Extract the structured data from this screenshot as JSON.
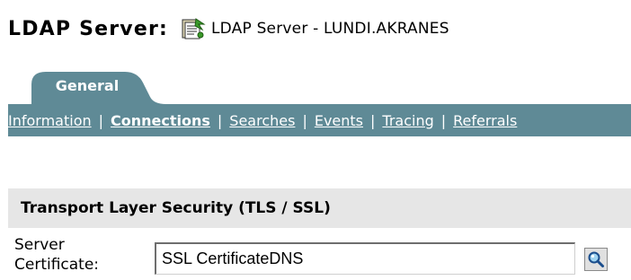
{
  "header": {
    "label": "LDAP Server:",
    "object_icon": "ldap-server-object-icon",
    "object_name": "LDAP Server - LUNDI.AKRANES"
  },
  "tabs": [
    {
      "label": "General",
      "selected": true
    }
  ],
  "subnav": {
    "items": [
      {
        "label": "Information",
        "active": false
      },
      {
        "label": "Connections",
        "active": true
      },
      {
        "label": "Searches",
        "active": false
      },
      {
        "label": "Events",
        "active": false
      },
      {
        "label": "Tracing",
        "active": false
      },
      {
        "label": "Referrals",
        "active": false
      }
    ],
    "separator": "|"
  },
  "section": {
    "title": "Transport Layer Security (TLS / SSL)"
  },
  "server_certificate": {
    "label_line1": "Server",
    "label_line2": "Certificate:",
    "value": "SSL CertificateDNS",
    "browse_icon": "magnifier-icon"
  },
  "colors": {
    "tab_bg": "#5f8a96",
    "section_bg": "#e6e6e6",
    "text": "#000000",
    "nav_text": "#ffffff"
  }
}
